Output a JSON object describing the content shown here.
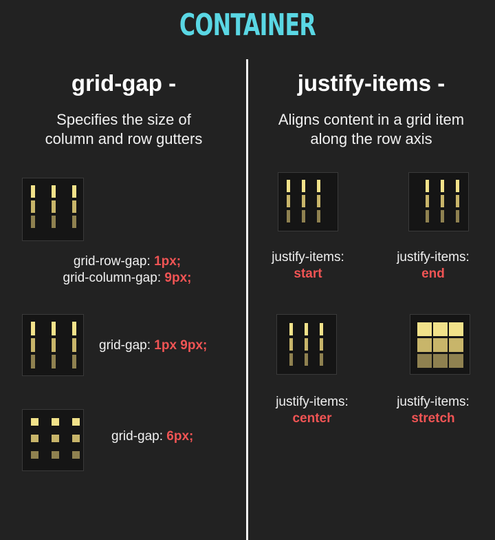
{
  "title": "CONTAINER",
  "left": {
    "heading": "grid-gap -",
    "description": [
      "Specifies the size of",
      "column and row gutters"
    ],
    "examples": [
      {
        "lines": [
          {
            "prop": "grid-row-gap:",
            "value": "1px;"
          },
          {
            "prop": "grid-column-gap:",
            "value": "9px;"
          }
        ]
      },
      {
        "lines": [
          {
            "prop": "grid-gap:",
            "value": "1px 9px;"
          }
        ]
      },
      {
        "lines": [
          {
            "prop": "grid-gap:",
            "value": "6px;"
          }
        ]
      }
    ]
  },
  "right": {
    "heading": "justify-items -",
    "description": [
      "Aligns content in a grid item",
      "along the row axis"
    ],
    "examples": [
      {
        "prop": "justify-items:",
        "value": "start"
      },
      {
        "prop": "justify-items:",
        "value": "end"
      },
      {
        "prop": "justify-items:",
        "value": "center"
      },
      {
        "prop": "justify-items:",
        "value": "stretch"
      }
    ]
  },
  "colors": {
    "title": "#5ad7e4",
    "value_highlight": "#f05454",
    "background": "#222222",
    "cell_row_1": "#f2e28a",
    "cell_row_2": "#c8b56a",
    "cell_row_3": "#8f8150"
  }
}
